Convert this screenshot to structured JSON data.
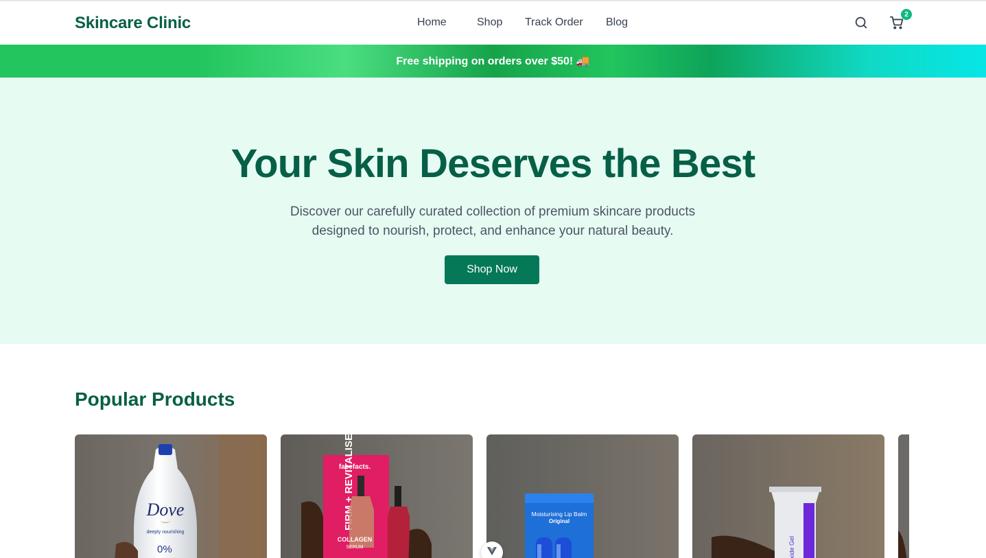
{
  "header": {
    "logo": "Skincare Clinic",
    "nav": [
      {
        "label": "Home"
      },
      {
        "label": "Shop"
      },
      {
        "label": "Track Order"
      },
      {
        "label": "Blog"
      }
    ],
    "search_icon": "search-icon",
    "cart_icon": "cart-icon",
    "cart_count": "2"
  },
  "promo": {
    "text": "Free shipping on orders over $50! 🚚"
  },
  "hero": {
    "title": "Your Skin Deserves the Best",
    "subtitle_line1": "Discover our carefully curated collection of premium skincare products",
    "subtitle_line2": "designed to nourish, protect, and enhance your natural beauty.",
    "cta": "Shop Now"
  },
  "products": {
    "title": "Popular Products",
    "items": [
      {
        "image": "dove-body-wash-image",
        "label_brand": "Dove",
        "label_line": "deeply nourishing",
        "label_pct": "0%"
      },
      {
        "image": "face-facts-serum-image",
        "label_brand": "facefacts.",
        "label_main": "FIRM + REVITALISE",
        "label_sub": "COLLAGEN",
        "label_sub2": "SERUM"
      },
      {
        "image": "lip-balm-image",
        "label_main": "Moisturising Lip Balm",
        "label_sub": "Original"
      },
      {
        "image": "gel-tube-image",
        "label_main": "Peroxide Gel"
      },
      {
        "image": "partial-product-image"
      }
    ]
  },
  "colors": {
    "brand": "#065f46",
    "button": "#047857",
    "hero_bg": "#e6fcf3",
    "badge": "#10b981"
  }
}
